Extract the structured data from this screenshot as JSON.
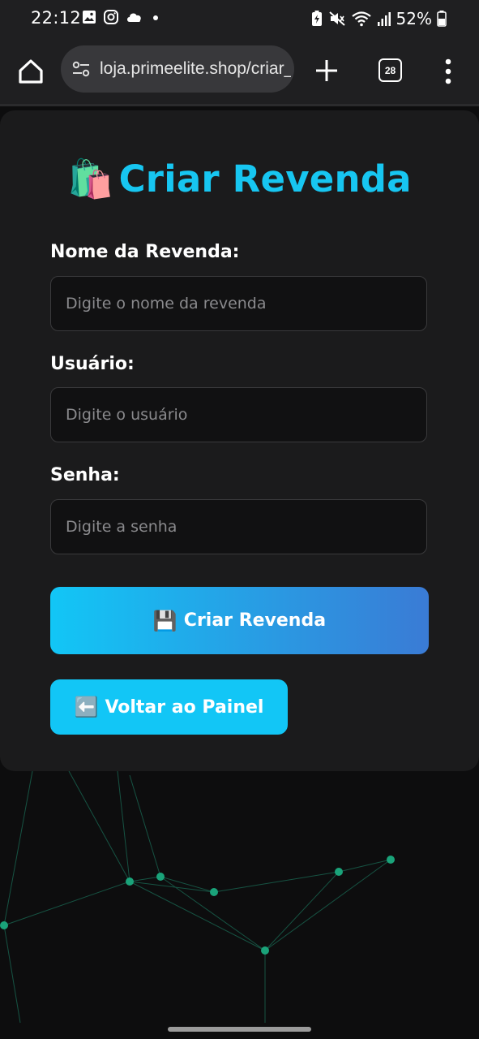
{
  "status_bar": {
    "time": "22:12",
    "battery": "52%"
  },
  "browser": {
    "url": "loja.primeelite.shop/criar_",
    "tab_count": "28"
  },
  "page": {
    "title_emoji": "🛍️",
    "title": "Criar Revenda",
    "form": {
      "name_label": "Nome da Revenda:",
      "name_placeholder": "Digite o nome da revenda",
      "user_label": "Usuário:",
      "user_placeholder": "Digite o usuário",
      "password_label": "Senha:",
      "password_placeholder": "Digite a senha"
    },
    "submit_emoji": "💾",
    "submit_label": "Criar Revenda",
    "back_emoji": "⬅️",
    "back_label": "Voltar ao Painel"
  },
  "colors": {
    "accent": "#17c6f1",
    "gradient_start": "#12c6f6",
    "gradient_end": "#3a7bd5",
    "network": "#1aa37a"
  },
  "icons": [
    "home-icon",
    "site-settings-icon",
    "plus-icon",
    "tab-switcher-icon",
    "more-vert-icon",
    "image-icon",
    "instagram-icon",
    "cloud-icon",
    "wifi-icon",
    "signal-icon",
    "battery-icon",
    "mute-icon"
  ]
}
